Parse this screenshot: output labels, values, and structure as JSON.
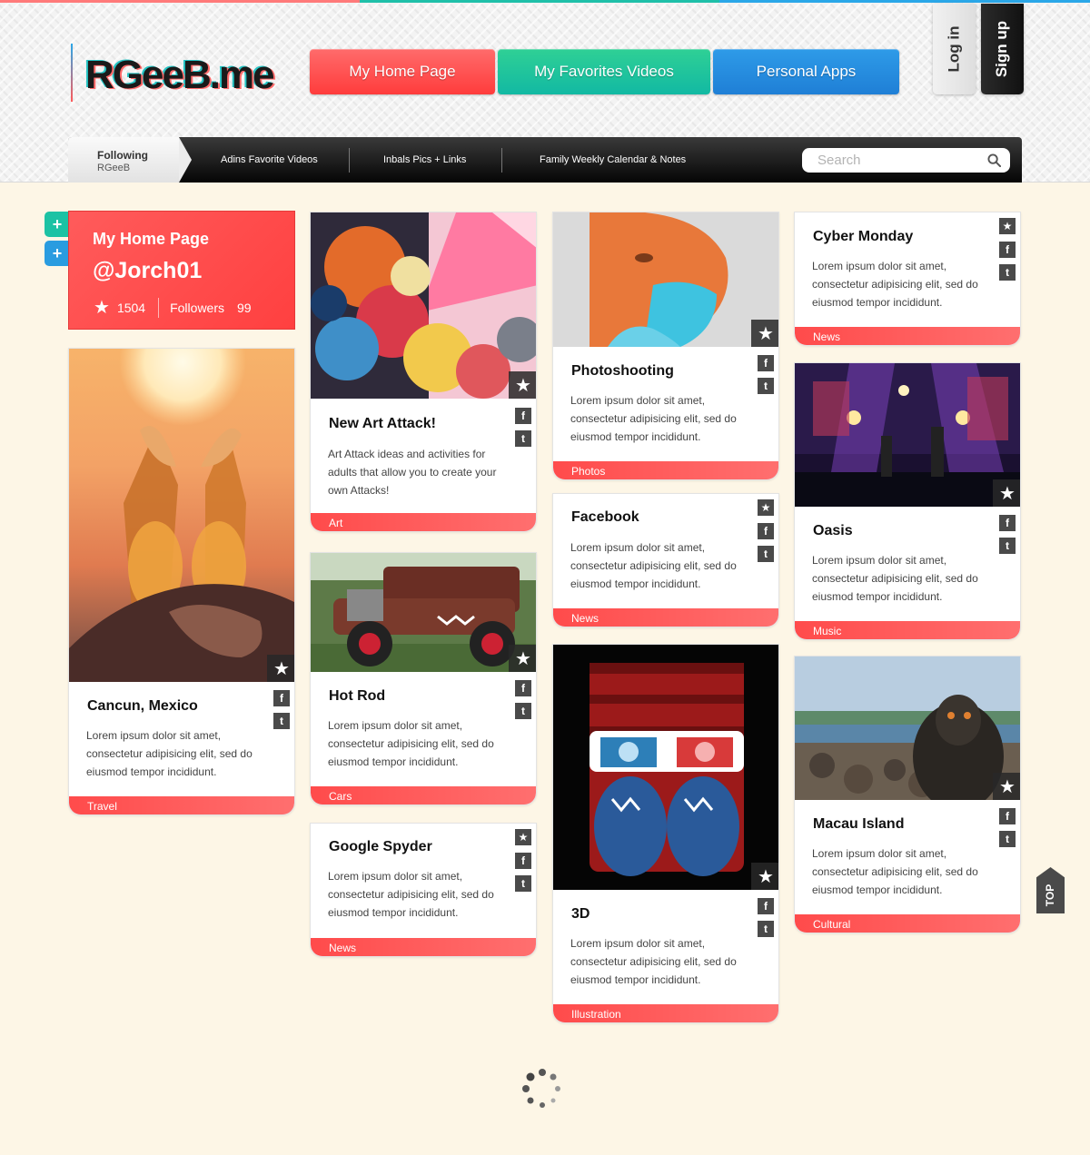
{
  "logo": "RGeeB.me",
  "main_tabs": [
    "My Home Page",
    "My Favorites Videos",
    "Personal Apps"
  ],
  "auth": {
    "login": "Log in",
    "signup": "Sign up"
  },
  "nav": {
    "following_label": "Following",
    "following_user": "RGeeB",
    "links": [
      "Adins Favorite Videos",
      "Inbals Pics + Links",
      "Family Weekly Calendar & Notes"
    ],
    "search_placeholder": "Search"
  },
  "profile": {
    "title": "My Home Page",
    "username": "@Jorch01",
    "stars": "1504",
    "followers_label": "Followers",
    "followers": "99"
  },
  "cards": {
    "cancun": {
      "title": "Cancun, Mexico",
      "desc": "Lorem ipsum dolor sit amet, consectetur adipisicing elit, sed do eiusmod tempor incididunt.",
      "tag": "Travel"
    },
    "art": {
      "title": "New Art Attack!",
      "desc": "Art Attack ideas and activities for adults that allow you to create your own Attacks!",
      "tag": "Art"
    },
    "hotrod": {
      "title": "Hot Rod",
      "desc": "Lorem ipsum dolor sit amet, consectetur adipisicing elit, sed do eiusmod tempor incididunt.",
      "tag": "Cars"
    },
    "google": {
      "title": "Google Spyder",
      "desc": "Lorem ipsum dolor sit amet, consectetur adipisicing elit, sed do eiusmod tempor incididunt.",
      "tag": "News"
    },
    "photo": {
      "title": "Photoshooting",
      "desc": "Lorem ipsum dolor sit amet, consectetur adipisicing elit, sed do eiusmod tempor incididunt.",
      "tag": "Photos"
    },
    "facebook": {
      "title": "Facebook",
      "desc": "Lorem ipsum dolor sit amet, consectetur adipisicing elit, sed do eiusmod tempor incididunt.",
      "tag": "News"
    },
    "three_d": {
      "title": "3D",
      "desc": "Lorem ipsum dolor sit amet, consectetur adipisicing elit, sed do eiusmod tempor incididunt.",
      "tag": "Illustration"
    },
    "cyber": {
      "title": "Cyber Monday",
      "desc": "Lorem ipsum dolor sit amet, consectetur adipisicing elit, sed do eiusmod tempor incididunt.",
      "tag": "News"
    },
    "oasis": {
      "title": "Oasis",
      "desc": "Lorem ipsum dolor sit amet, consectetur adipisicing elit, sed do eiusmod tempor incididunt.",
      "tag": "Music"
    },
    "macau": {
      "title": "Macau Island",
      "desc": "Lorem ipsum dolor sit amet, consectetur adipisicing elit, sed do eiusmod tempor incididunt.",
      "tag": "Cultural"
    }
  },
  "top_button": "TOP",
  "icons": {
    "star": "star-icon",
    "facebook": "facebook-icon",
    "twitter": "twitter-icon",
    "search": "search-icon",
    "plus": "plus-icon",
    "spinner": "loading-spinner-icon"
  },
  "colors": {
    "red": "#ff4b4b",
    "green": "#1cc2a4",
    "blue": "#2a9ce0",
    "dark": "#4a4a4a"
  }
}
